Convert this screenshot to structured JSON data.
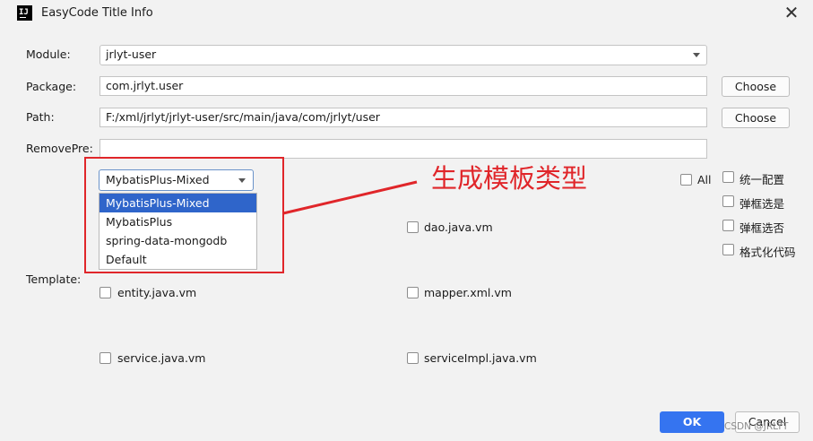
{
  "window": {
    "title": "EasyCode Title Info",
    "app_icon_text": "IJ"
  },
  "form": {
    "module_label": "Module:",
    "module_value": "jrlyt-user",
    "package_label": "Package:",
    "package_value": "com.jrlyt.user",
    "package_choose": "Choose",
    "path_label": "Path:",
    "path_value": "F:/xml/jrlyt/jrlyt-user/src/main/java/com/jrlyt/user",
    "path_choose": "Choose",
    "removepre_label": "RemovePre:",
    "removepre_value": "",
    "template_label": "Template:"
  },
  "template_group": {
    "selected": "MybatisPlus-Mixed",
    "options": [
      "MybatisPlus-Mixed",
      "MybatisPlus",
      "spring-data-mongodb",
      "Default"
    ]
  },
  "templates": {
    "all_label": "All",
    "dao": "dao.java.vm",
    "entity": "entity.java.vm",
    "mapper": "mapper.xml.vm",
    "service": "service.java.vm",
    "serviceImpl": "serviceImpl.java.vm"
  },
  "options": {
    "unified_config": "统一配置",
    "popup_select": "弹框选是",
    "popup_no": "弹框选否",
    "format_code": "格式化代码"
  },
  "annotation": {
    "text": "生成模板类型",
    "color": "#e0262a"
  },
  "footer": {
    "ok_label": "OK",
    "cancel_label": "Cancel"
  },
  "watermark": "CSDN @JRLYT"
}
